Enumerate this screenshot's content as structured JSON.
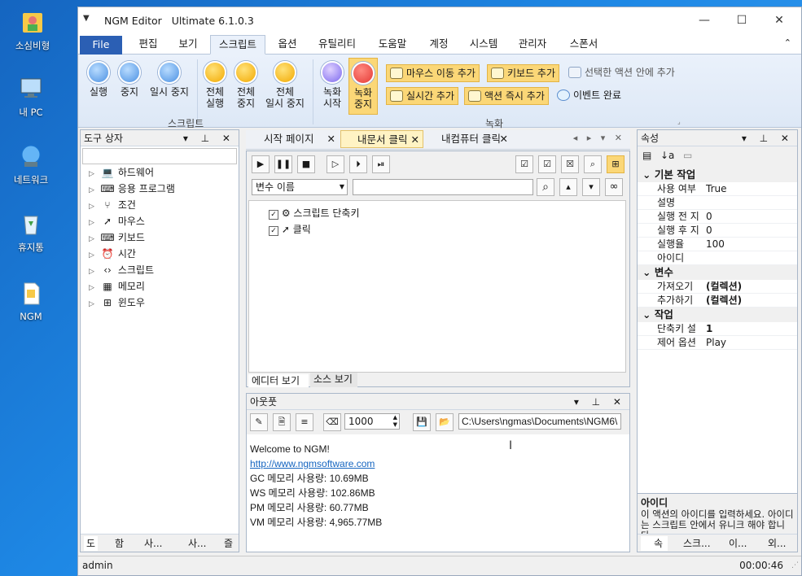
{
  "desktop": {
    "icons": [
      {
        "label": "소심비형",
        "icon": "user-folder-icon"
      },
      {
        "label": "내 PC",
        "icon": "computer-icon"
      },
      {
        "label": "네트워크",
        "icon": "network-icon"
      },
      {
        "label": "휴지통",
        "icon": "recycle-bin-icon"
      },
      {
        "label": "NGM",
        "icon": "document-icon"
      }
    ]
  },
  "window": {
    "app_name": "NGM Editor",
    "edition": "Ultimate 6.1.0.3",
    "controls": {
      "minimize": "—",
      "maximize": "☐",
      "close": "✕"
    }
  },
  "ribbon_tabs": [
    "File",
    "편집",
    "보기",
    "스크립트",
    "옵션",
    "유틸리티",
    "도움말",
    "계정",
    "시스템",
    "관리자",
    "스폰서"
  ],
  "ribbon": {
    "script_group": {
      "label": "스크립트",
      "buttons": [
        {
          "label": "실행"
        },
        {
          "label": "중지"
        },
        {
          "label": "일시 중지"
        },
        {
          "label": "전체\n실행"
        },
        {
          "label": "전체\n중지"
        },
        {
          "label": "전체\n일시 중지"
        }
      ]
    },
    "record_group": {
      "label": "녹화",
      "buttons": [
        {
          "label": "녹화\n시작"
        },
        {
          "label": "녹화\n중지"
        }
      ],
      "small_buttons": [
        {
          "label": "마우스 이동 추가"
        },
        {
          "label": "키보드 추가"
        },
        {
          "label": "선택한 액션 안에 추가"
        },
        {
          "label": "실시간 추가"
        },
        {
          "label": "액션 즉시 추가"
        },
        {
          "label": "이벤트 완료"
        }
      ]
    }
  },
  "toolbox": {
    "title": "도구 상자",
    "items": [
      {
        "label": "하드웨어",
        "icon": "laptop-icon"
      },
      {
        "label": "응용 프로그램",
        "icon": "terminal-icon"
      },
      {
        "label": "조건",
        "icon": "branch-icon"
      },
      {
        "label": "마우스",
        "icon": "mouse-pointer-icon"
      },
      {
        "label": "키보드",
        "icon": "keyboard-icon"
      },
      {
        "label": "시간",
        "icon": "clock-icon"
      },
      {
        "label": "스크립트",
        "icon": "code-icon"
      },
      {
        "label": "메모리",
        "icon": "memory-icon"
      },
      {
        "label": "윈도우",
        "icon": "windows-icon"
      }
    ],
    "bottom_tabs": [
      "도",
      "함",
      "사...",
      "사...",
      "즐"
    ]
  },
  "document_tabs": [
    {
      "label": "시작 페이지"
    },
    {
      "label": "내문서 클릭"
    },
    {
      "label": "내컴퓨터 클릭"
    }
  ],
  "editor": {
    "variable_select": "변수 이름",
    "script_items": [
      {
        "label": "스크립트 단축키",
        "checked": true
      },
      {
        "label": "클릭",
        "checked": true
      }
    ],
    "view_tabs": [
      "에디터 보기",
      "소스 보기"
    ]
  },
  "output": {
    "title": "아웃풋",
    "interval": "1000",
    "path": "C:\\Users\\ngmas\\Documents\\NGM6\\",
    "lines": [
      {
        "text": "Welcome to NGM!",
        "link": false
      },
      {
        "text": "http://www.ngmsoftware.com",
        "link": true
      },
      {
        "text": "GC 메모리 사용량: 10.69MB",
        "link": false
      },
      {
        "text": "WS 메모리 사용량: 102.86MB",
        "link": false
      },
      {
        "text": "PM 메모리 사용량: 60.77MB",
        "link": false
      },
      {
        "text": "VM 메모리 사용량: 4,965.77MB",
        "link": false
      }
    ]
  },
  "properties": {
    "title": "속성",
    "categories": [
      {
        "name": "기본 작업",
        "rows": [
          {
            "key": "사용 여부",
            "value": "True"
          },
          {
            "key": "설명",
            "value": ""
          },
          {
            "key": "실행 전 지",
            "value": "0"
          },
          {
            "key": "실행 후 지",
            "value": "0"
          },
          {
            "key": "실행율",
            "value": "100"
          },
          {
            "key": "아이디",
            "value": ""
          }
        ]
      },
      {
        "name": "변수",
        "rows": [
          {
            "key": "가져오기",
            "value": "(컬렉션)"
          },
          {
            "key": "추가하기",
            "value": "(컬렉션)"
          }
        ]
      },
      {
        "name": "작업",
        "rows": [
          {
            "key": "단축키 설",
            "value": "1"
          },
          {
            "key": "제어 옵션",
            "value": "Play"
          }
        ]
      }
    ],
    "desc_title": "아이디",
    "desc_text": "이 액션의 아이디를 입력하세요. 아이디는 스크립트 안에서 유니크 해야 합니다.",
    "bottom_tabs": [
      "속",
      "스크...",
      "이...",
      "외..."
    ]
  },
  "status": {
    "user": "admin",
    "time": "00:00:46"
  }
}
